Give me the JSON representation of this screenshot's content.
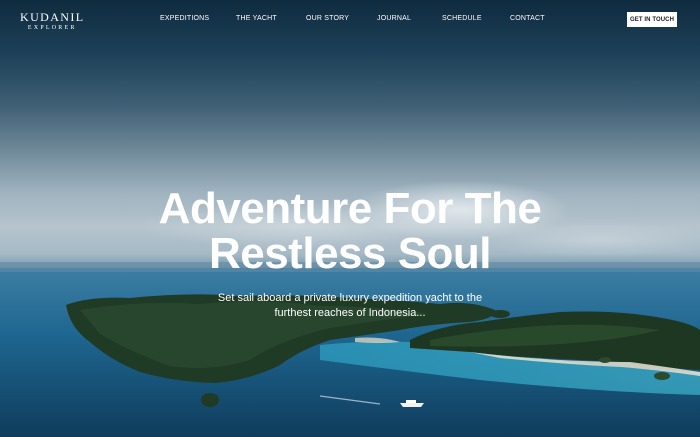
{
  "brand": {
    "name": "KUDANIL",
    "tagline": "EXPLORER"
  },
  "nav": {
    "items": [
      {
        "label": "EXPEDITIONS"
      },
      {
        "label": "THE YACHT"
      },
      {
        "label": "OUR STORY"
      },
      {
        "label": "JOURNAL"
      },
      {
        "label": "SCHEDULE"
      },
      {
        "label": "CONTACT"
      }
    ],
    "cta_label": "GET IN TOUCH"
  },
  "hero": {
    "headline_line1": "Adventure For The",
    "headline_line2": "Restless Soul",
    "subheadline_line1": "Set sail aboard a private luxury expedition yacht to the",
    "subheadline_line2": "furthest reaches of Indonesia..."
  },
  "colors": {
    "text": "#ffffff",
    "cta_background": "#ffffff",
    "cta_text": "#1a1a1a"
  }
}
